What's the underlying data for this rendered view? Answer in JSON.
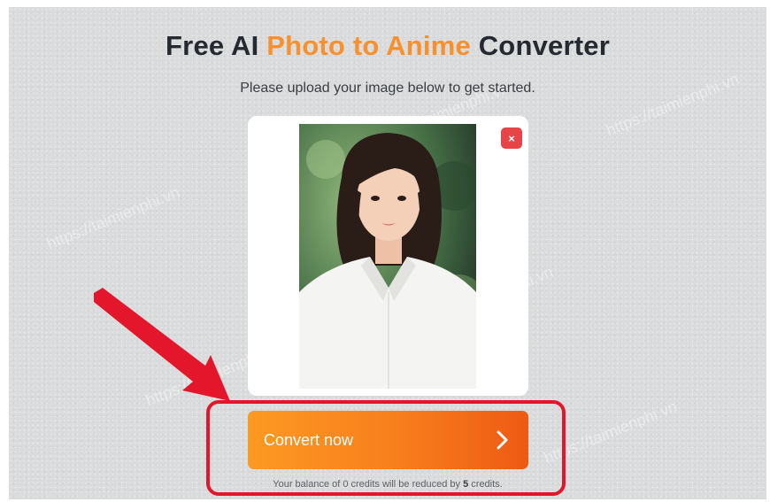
{
  "header": {
    "title_part1": "Free AI ",
    "title_accent": "Photo to Anime",
    "title_part2": " Converter",
    "subtitle": "Please upload your image below to get started."
  },
  "upload": {
    "close_symbol": "×"
  },
  "action": {
    "convert_label": "Convert now",
    "balance_part1": "Your balance of 0 credits will be reduced by ",
    "balance_credits": "5",
    "balance_part2": " credits."
  },
  "watermarks": [
    "https://taimienphi.vn",
    "https://taimienphi.vn",
    "https://taimienphi.vn",
    "https://taimienphi.vn",
    "https://taimienphi.vn",
    "https://taimienphi.vn"
  ],
  "colors": {
    "accent": "#f7902d",
    "button_start": "#fd9a23",
    "button_end": "#ee5a13",
    "highlight": "#e3162b",
    "close": "#e64446"
  },
  "icons": {
    "close": "close-icon",
    "next": "chevron-right-icon",
    "pointer": "red-arrow-icon"
  }
}
